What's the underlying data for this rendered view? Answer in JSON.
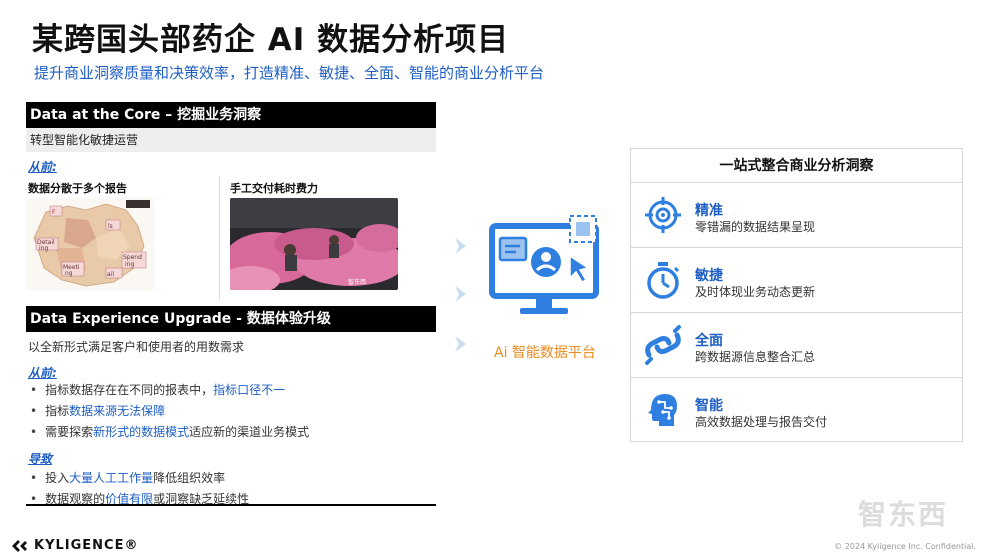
{
  "header": {
    "title": "某跨国头部药企 AI 数据分析项目",
    "subtitle": "提升商业洞察质量和决策效率，打造精准、敏捷、全面、智能的商业分析平台"
  },
  "section1": {
    "bar": "Data at the Core – 挖掘业务洞察",
    "gray": "转型智能化敏捷运营",
    "before_label": "从前:",
    "left_heading": "数据分散于多个报告",
    "right_heading": "手工交付耗时费力",
    "map_labels": [
      "F",
      "Detail",
      "ing",
      "Meeti",
      "ng",
      "Spend",
      "ing",
      "ls",
      "ail"
    ],
    "photo_caption": "智东西"
  },
  "section2": {
    "bar": "Data Experience Upgrade - 数据体验升级",
    "intro": "以全新形式满足客户和使用者的用数需求",
    "before_label": "从前:",
    "before_items": [
      {
        "pre": "指标数据存在在不同的报表中，",
        "hl": "指标口径不一",
        "post": ""
      },
      {
        "pre": "指标",
        "hl": "数据来源无法保障",
        "post": ""
      },
      {
        "pre": "需要探索",
        "hl": "新形式的数据模式",
        "post": "适应新的渠道业务模式"
      }
    ],
    "result_label": "导致",
    "result_items": [
      {
        "pre": "投入",
        "hl": "大量人工工作量",
        "post": "降低组织效率"
      },
      {
        "pre": "数据观察的",
        "hl": "价值有限",
        "post": "或洞察缺乏延续性"
      }
    ]
  },
  "platform": {
    "label": "Ai 智能数据平台"
  },
  "right_card": {
    "header": "一站式整合商业分析洞察",
    "rows": [
      {
        "icon": "target-icon",
        "title": "精准",
        "desc": "零错漏的数据结果呈现"
      },
      {
        "icon": "stopwatch-icon",
        "title": "敏捷",
        "desc": "及时体现业务动态更新"
      },
      {
        "icon": "chain-link-icon",
        "title": "全面",
        "desc": "跨数据源信息整合汇总"
      },
      {
        "icon": "brain-head-icon",
        "title": "智能",
        "desc": "高效数据处理与报告交付"
      }
    ]
  },
  "footer": {
    "logo": "KYLIGENCE®",
    "copyright": "© 2024 Kyligence Inc. Confidential.",
    "watermark": "智东西"
  },
  "colors": {
    "accent_blue": "#1f5fc4",
    "icon_blue": "#2f7fe0",
    "platform_orange": "#f08a1c",
    "bar_black": "#000000"
  }
}
